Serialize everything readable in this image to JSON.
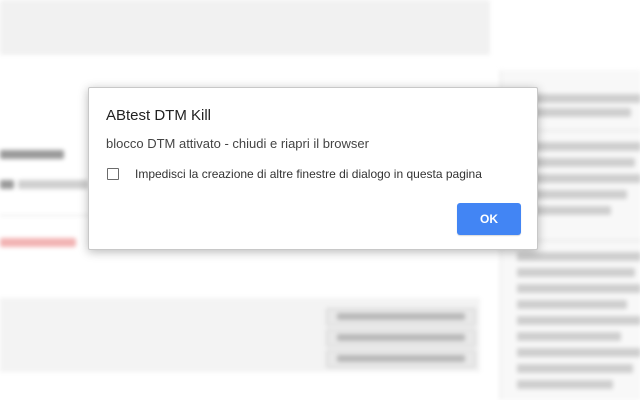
{
  "dialog": {
    "title": "ABtest DTM Kill",
    "message": "blocco DTM attivato - chiudi e riapri il browser",
    "suppress_checkbox": {
      "label": "Impedisci la creazione di altre finestre di dialogo in questa pagina",
      "checked": false
    },
    "ok_label": "OK"
  },
  "colors": {
    "accent": "#4285f4",
    "dialog_background": "#ffffff",
    "page_background": "#ffffff"
  }
}
